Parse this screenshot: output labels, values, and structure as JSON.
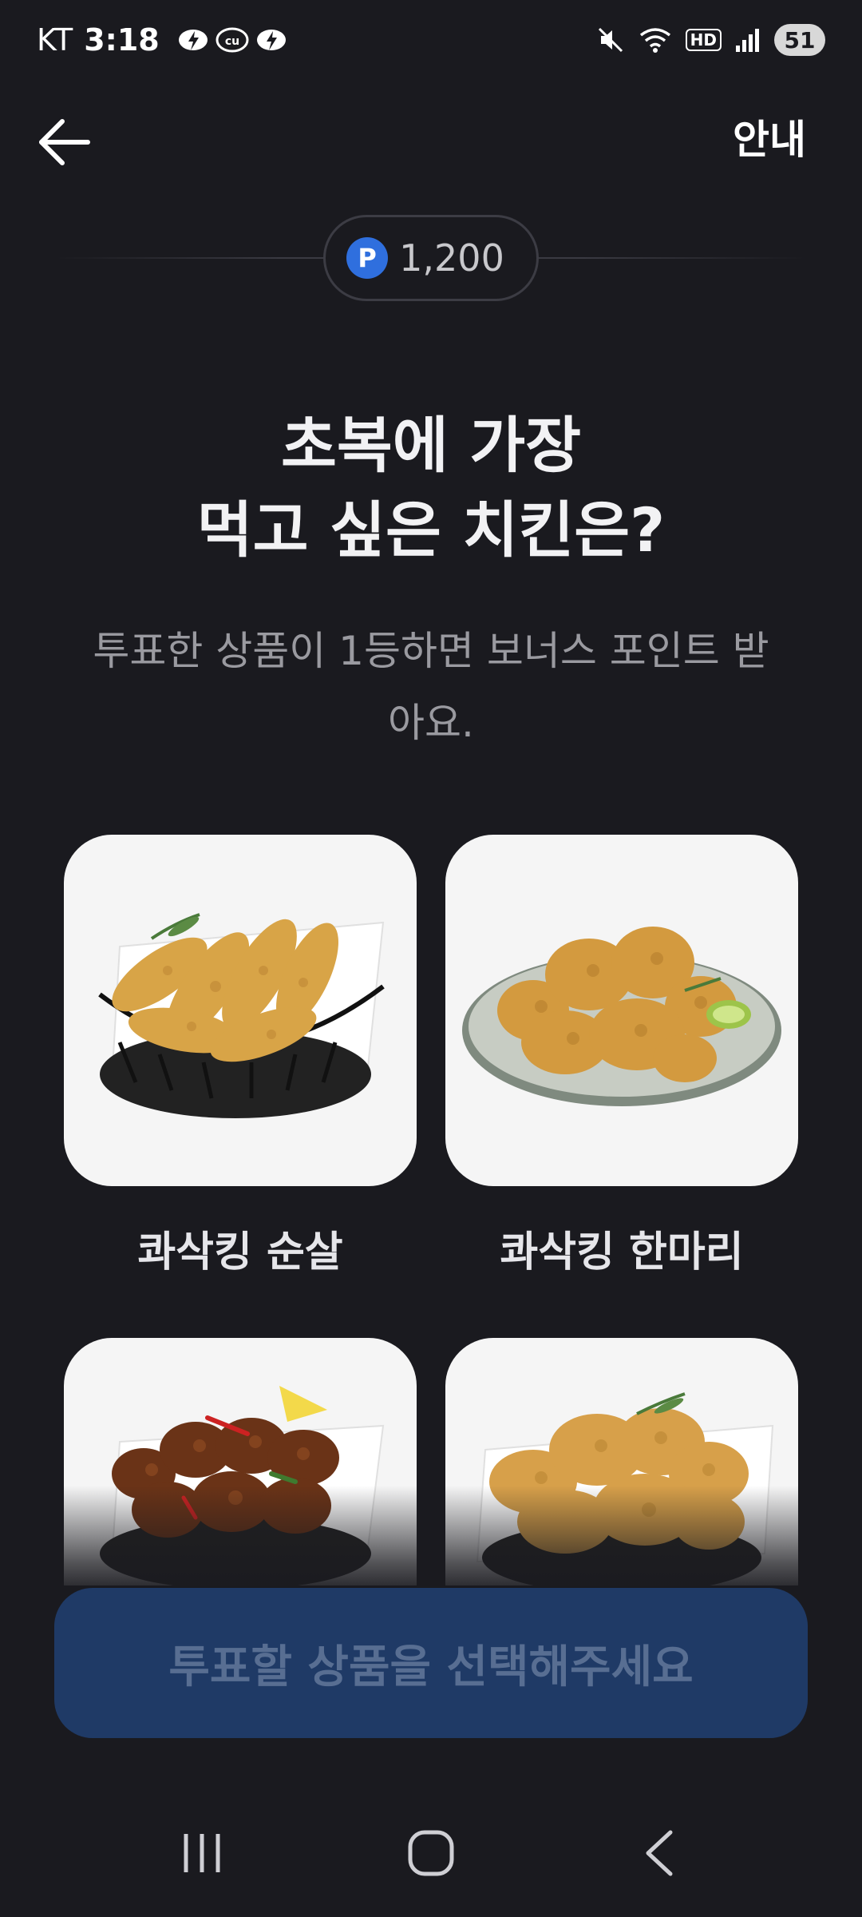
{
  "status_bar": {
    "carrier": "KT",
    "time": "3:18",
    "battery": "51",
    "hd_label": "HD"
  },
  "nav": {
    "guide_label": "안내"
  },
  "points": {
    "icon_letter": "P",
    "value": "1,200",
    "icon_color": "#2f6fde"
  },
  "question": {
    "line1": "초복에 가장",
    "line2": "먹고 싶은 치킨은?"
  },
  "subtext": "투표한 상품이 1등하면 보너스 포인트 받아요.",
  "products": [
    {
      "label": "콰삭킹 순살",
      "image_icon": "boneless-chicken-basket"
    },
    {
      "label": "콰삭킹 한마리",
      "image_icon": "whole-chicken-plate"
    },
    {
      "label": "",
      "image_icon": "spicy-glazed-chicken-basket"
    },
    {
      "label": "",
      "image_icon": "crispy-chicken-basket"
    }
  ],
  "cta": {
    "label": "투표할 상품을 선택해주세요",
    "color": "#1f3a66"
  },
  "icons": {
    "back": "arrow-left-icon",
    "recents": "recent-apps-icon",
    "home": "home-icon",
    "back_nav": "back-nav-icon"
  }
}
